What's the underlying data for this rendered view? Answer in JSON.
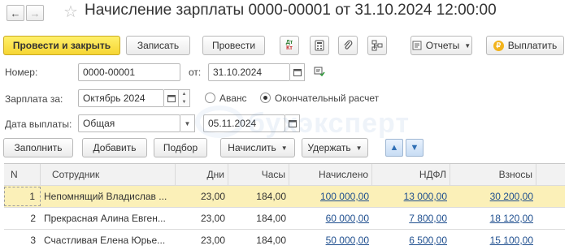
{
  "window": {
    "title": "Начисление зарплаты 0000-00001 от 31.10.2024 12:00:00"
  },
  "nav": {
    "back_icon": "←",
    "forward_icon": "→",
    "favorite_icon": "☆"
  },
  "toolbar": {
    "post_and_close": "Провести и закрыть",
    "save": "Записать",
    "post": "Провести",
    "reports": "Отчеты",
    "pay": "Выплатить",
    "dt_label": "Дт",
    "kt_label": "Кт"
  },
  "form": {
    "number_label": "Номер:",
    "number_value": "0000-00001",
    "date_label": "от:",
    "date_value": "31.10.2024",
    "salary_for_label": "Зарплата за:",
    "salary_for_value": "Октябрь 2024",
    "advance_label": "Аванс",
    "final_label": "Окончательный расчет",
    "final_selected": true,
    "payout_date_label": "Дата выплаты:",
    "payout_type_value": "Общая",
    "payout_date_value": "05.11.2024"
  },
  "watermark": "бухэксперт",
  "table_toolbar": {
    "fill": "Заполнить",
    "add": "Добавить",
    "select": "Подбор",
    "accrue": "Начислить",
    "withhold": "Удержать"
  },
  "table": {
    "columns": [
      "N",
      "Сотрудник",
      "Дни",
      "Часы",
      "Начислено",
      "НДФЛ",
      "Взносы"
    ],
    "rows": [
      {
        "n": "1",
        "employee": "Непомнящий Владислав ...",
        "days": "23,00",
        "hours": "184,00",
        "accrued": "100 000,00",
        "ndfl": "13 000,00",
        "contributions": "30 200,00"
      },
      {
        "n": "2",
        "employee": "Прекрасная Алина Евген...",
        "days": "23,00",
        "hours": "184,00",
        "accrued": "60 000,00",
        "ndfl": "7 800,00",
        "contributions": "18 120,00"
      },
      {
        "n": "3",
        "employee": "Счастливая Елена Юрье...",
        "days": "23,00",
        "hours": "184,00",
        "accrued": "50 000,00",
        "ndfl": "6 500,00",
        "contributions": "15 100,00"
      }
    ]
  },
  "colors": {
    "primary_button": "#f6d533",
    "selected_row": "#fbf0b8",
    "link": "#1f4f8f"
  }
}
